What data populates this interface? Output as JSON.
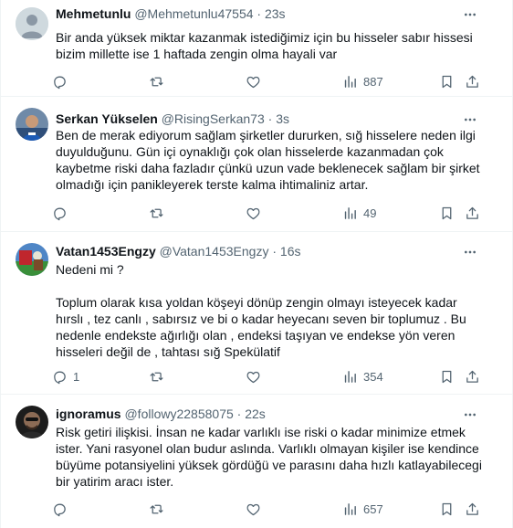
{
  "tweets": [
    {
      "name": "Mehmetunlu",
      "handle": "@Mehmetunlu47554",
      "time": "23s",
      "lines": [
        "Bir anda yüksek miktar kazanmak istediğimiz için bu hisseler sabır hissesi",
        "bizim millette ise 1 haftada zengin olma hayali var"
      ],
      "replies": "",
      "views": "887"
    },
    {
      "name": "Serkan Yükselen",
      "handle": "@RisingSerkan73",
      "time": "3s",
      "lines": [
        "Ben de merak ediyorum sağlam şirketler dururken, sığ hisselere neden ilgi",
        "duyulduğunu. Gün içi oynaklığı çok olan hisselerde kazanmadan çok",
        "kaybetme riski daha fazladır çünkü uzun vade beklenecek sağlam bir şirket",
        "olmadığı için panikleyerek terste kalma ihtimaliniz artar."
      ],
      "replies": "",
      "views": "49"
    },
    {
      "name": "Vatan1453Engzy",
      "handle": "@Vatan1453Engzy",
      "time": "16s",
      "lines": [
        "Nedeni mi ?",
        "",
        "Toplum olarak kısa yoldan köşeyi dönüp zengin olmayı isteyecek kadar",
        "hırslı , tez canlı , sabırsız ve bi o kadar heyecanı seven bir toplumuz . Bu",
        "nedenle endekste ağırlığı olan ,  endeksi taşıyan ve endekse yön veren",
        "hisseleri değil de , tahtası sığ Spekülatif"
      ],
      "replies": "1",
      "views": "354"
    },
    {
      "name": "ignoramus",
      "handle": "@followy22858075",
      "time": "22s",
      "lines": [
        "Risk getiri ilişkisi. İnsan ne kadar varlıklı ise riski o kadar minimize etmek",
        "ister. Yani rasyonel olan budur aslında. Varlıklı olmayan kişiler ise kendince",
        "büyüme potansiyelini yüksek gördüğü ve parasını daha hızlı katlayabilecegi",
        "bir yatirim aracı ister."
      ],
      "replies": "",
      "views": "657"
    }
  ],
  "icons": [
    "more-icon",
    "reply-icon",
    "retweet-icon",
    "like-icon",
    "views-icon",
    "bookmark-icon",
    "share-icon"
  ],
  "colors": {
    "text": "#0f1419",
    "secondary": "#536471",
    "divider": "#eff3f4"
  }
}
